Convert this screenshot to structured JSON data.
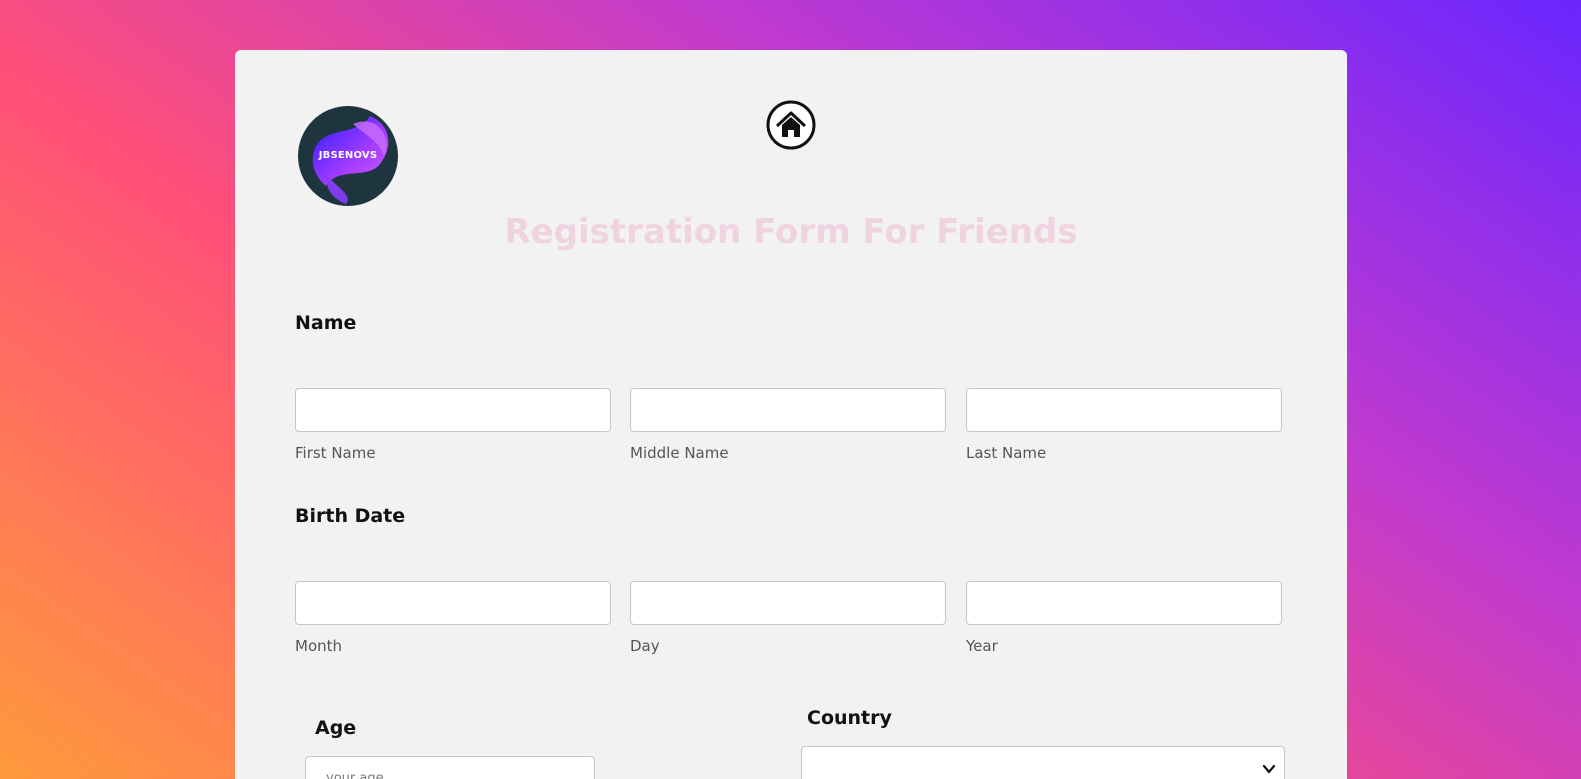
{
  "form": {
    "logo_text": "JBSENOVS",
    "title": "Registration Form For Friends",
    "name_section": {
      "label": "Name",
      "fields": [
        {
          "sub_label": "First Name",
          "value": ""
        },
        {
          "sub_label": "Middle Name",
          "value": ""
        },
        {
          "sub_label": "Last Name",
          "value": ""
        }
      ]
    },
    "birth_section": {
      "label": "Birth Date",
      "fields": [
        {
          "sub_label": "Month",
          "value": ""
        },
        {
          "sub_label": "Day",
          "value": ""
        },
        {
          "sub_label": "Year",
          "value": ""
        }
      ]
    },
    "age": {
      "label": "Age",
      "placeholder": "your age"
    },
    "country": {
      "label": "Country",
      "selected": ""
    }
  },
  "icons": {
    "home": "home-icon",
    "logo": "logo-icon",
    "dropdown": "chevron-down-icon"
  },
  "colors": {
    "background_gradient": [
      "#ff9a3c",
      "#ff4f79",
      "#c03ad0",
      "#6a26ff"
    ],
    "card": "#f2f2f2",
    "title": "#f0d3e0"
  }
}
